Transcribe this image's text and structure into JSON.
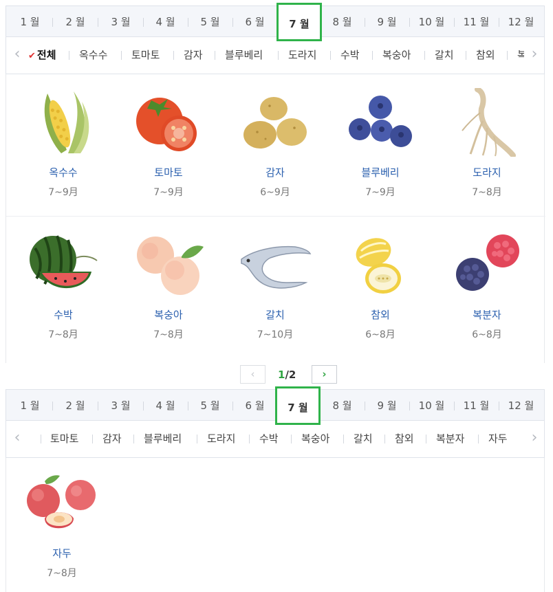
{
  "colors": {
    "accent_green": "#2fb34a",
    "name_blue": "#2a5fae",
    "check_red": "#e03131"
  },
  "months": [
    "1 월",
    "2 월",
    "3 월",
    "4 월",
    "5 월",
    "6 월",
    "7 월",
    "8 월",
    "9 월",
    "10 월",
    "11 월",
    "12 월"
  ],
  "selected_month": "7 월",
  "panel1": {
    "categories": [
      "전체",
      "옥수수",
      "토마토",
      "감자",
      "블루베리",
      "도라지",
      "수박",
      "복숭아",
      "갈치",
      "참외",
      "복"
    ],
    "items": [
      {
        "name": "옥수수",
        "period": "7~9月",
        "icon": "corn-icon"
      },
      {
        "name": "토마토",
        "period": "7~9月",
        "icon": "tomato-icon"
      },
      {
        "name": "감자",
        "period": "6~9月",
        "icon": "potato-icon"
      },
      {
        "name": "블루베리",
        "period": "7~9月",
        "icon": "blueberry-icon"
      },
      {
        "name": "도라지",
        "period": "7~8月",
        "icon": "bellflower-root-icon"
      },
      {
        "name": "수박",
        "period": "7~8月",
        "icon": "watermelon-icon"
      },
      {
        "name": "복숭아",
        "period": "7~8月",
        "icon": "peach-icon"
      },
      {
        "name": "갈치",
        "period": "7~10月",
        "icon": "hairtail-fish-icon"
      },
      {
        "name": "참외",
        "period": "6~8月",
        "icon": "korean-melon-icon"
      },
      {
        "name": "복분자",
        "period": "6~8月",
        "icon": "raspberry-icon"
      }
    ],
    "pager": {
      "current": "1",
      "total": "/2",
      "prev": "‹",
      "next": "›"
    }
  },
  "panel2": {
    "categories": [
      "토마토",
      "감자",
      "블루베리",
      "도라지",
      "수박",
      "복숭아",
      "갈치",
      "참외",
      "복분자",
      "자두"
    ],
    "items": [
      {
        "name": "자두",
        "period": "7~8月",
        "icon": "plum-icon"
      }
    ]
  },
  "nav": {
    "left_arrow": "‹",
    "right_arrow": "›",
    "check": "✔"
  }
}
